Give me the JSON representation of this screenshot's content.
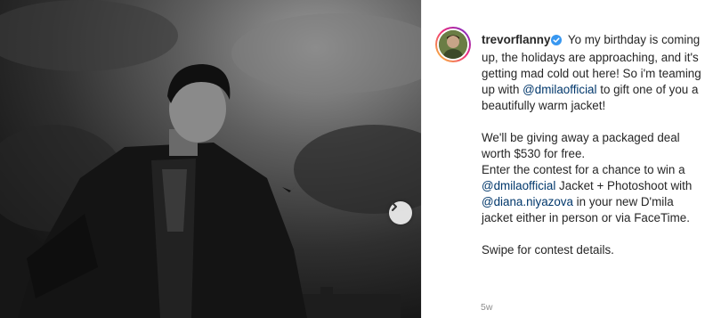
{
  "post": {
    "username": "trevorflanny",
    "caption_lines_a": [
      "Yo my birthday is coming up, the holidays are approaching, and it's getting mad cold out here! So i'm teaming up with"
    ],
    "mention_1": "@dmilaofficial",
    "caption_a_tail": "to gift one of you a beautifully warm jacket!",
    "caption_b": "We'll be giving away a packaged deal worth $530 for free.",
    "caption_c_head": "Enter the contest for a chance to win a",
    "mention_2": "@dmilaofficial",
    "caption_c_mid": "Jacket + Photoshoot with",
    "mention_3": "@diana.niyazova",
    "caption_c_tail": "in your new D'mila jacket either in person or via FaceTime.",
    "caption_d": "Swipe for contest details.",
    "timestamp": "5w"
  },
  "icons": {
    "verified": "verified-badge-icon",
    "carousel_next": "chevron-right-icon"
  },
  "colors": {
    "text": "#262626",
    "mention": "#00376b",
    "verified": "#3897f0",
    "muted": "#8e8e8e"
  }
}
